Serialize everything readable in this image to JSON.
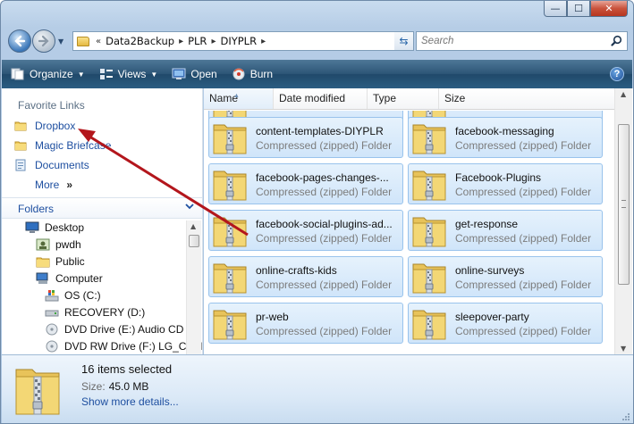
{
  "window": {
    "min_glyph": "—",
    "max_glyph": "☐",
    "close_glyph": "✕"
  },
  "address": {
    "overflow": "«",
    "crumbs": [
      "Data2Backup",
      "PLR",
      "DIYPLR"
    ],
    "separator": "▸"
  },
  "search": {
    "placeholder": "Search"
  },
  "toolbar": {
    "organize": "Organize",
    "views": "Views",
    "open": "Open",
    "burn": "Burn",
    "help": "?"
  },
  "favorites": {
    "title": "Favorite Links",
    "items": [
      "Dropbox",
      "Magic Briefcase",
      "Documents"
    ],
    "more": "More",
    "more_glyph": "»"
  },
  "folders": {
    "title": "Folders",
    "tree": [
      "Desktop",
      "pwdh",
      "Public",
      "Computer",
      "OS (C:)",
      "RECOVERY (D:)",
      "DVD Drive (E:) Audio CD",
      "DVD RW Drive (F:) LG_CON"
    ]
  },
  "columns": [
    "Name",
    "Date modified",
    "Type",
    "Size"
  ],
  "items": [
    {
      "name": "content-templates-DIYPLR",
      "type": "Compressed (zipped) Folder"
    },
    {
      "name": "facebook-messaging",
      "type": "Compressed (zipped) Folder"
    },
    {
      "name": "facebook-pages-changes-...",
      "type": "Compressed (zipped) Folder"
    },
    {
      "name": "Facebook-Plugins",
      "type": "Compressed (zipped) Folder"
    },
    {
      "name": "facebook-social-plugins-ad...",
      "type": "Compressed (zipped) Folder"
    },
    {
      "name": "get-response",
      "type": "Compressed (zipped) Folder"
    },
    {
      "name": "online-crafts-kids",
      "type": "Compressed (zipped) Folder"
    },
    {
      "name": "online-surveys",
      "type": "Compressed (zipped) Folder"
    },
    {
      "name": "pr-web",
      "type": "Compressed (zipped) Folder"
    },
    {
      "name": "sleepover-party",
      "type": "Compressed (zipped) Folder"
    }
  ],
  "details": {
    "selected": "16 items selected",
    "size_label": "Size:",
    "size_value": "45.0 MB",
    "more": "Show more details..."
  },
  "colors": {
    "link": "#1e4fa0",
    "toolbar": "#2c5576",
    "selection": "#d0e5fa",
    "arrow": "#b3161c"
  }
}
